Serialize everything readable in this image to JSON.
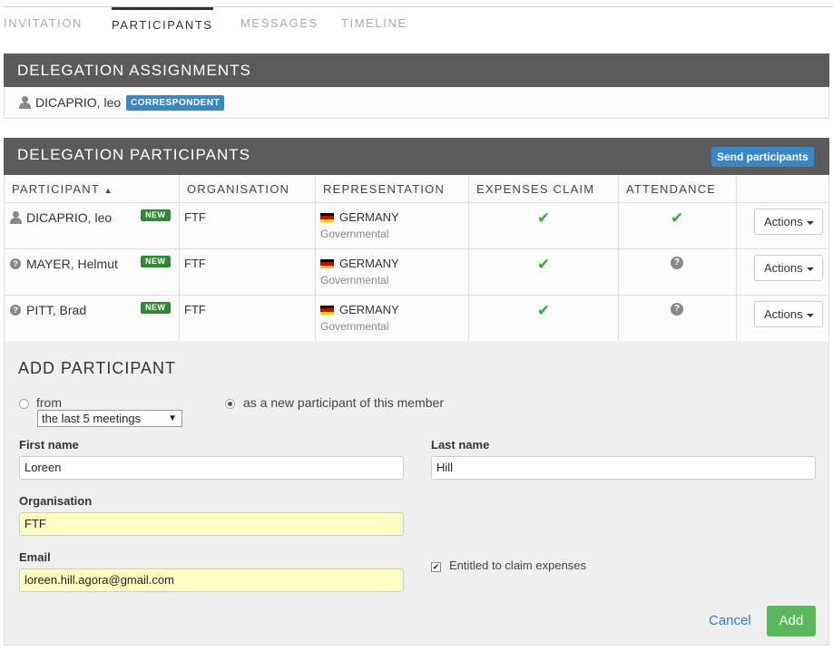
{
  "tabs": [
    {
      "label": "INVITATION",
      "active": false
    },
    {
      "label": "PARTICIPANTS",
      "active": true
    },
    {
      "label": "MESSAGES",
      "active": false
    },
    {
      "label": "TIMELINE",
      "active": false
    }
  ],
  "assignments": {
    "title": "DELEGATION ASSIGNMENTS",
    "person": "DICAPRIO, leo",
    "role_badge": "CORRESPONDENT"
  },
  "participants": {
    "title": "DELEGATION PARTICIPANTS",
    "send_button": "Send participants",
    "columns": {
      "participant": "PARTICIPANT",
      "organisation": "ORGANISATION",
      "representation": "REPRESENTATION",
      "expenses": "EXPENSES CLAIM",
      "attendance": "ATTENDANCE"
    },
    "sort_indicator": "▲",
    "rows": [
      {
        "name": "DICAPRIO, leo",
        "badge": "NEW",
        "org": "FTF",
        "country": "GERMANY",
        "rep_type": "Governmental",
        "expenses": "✔",
        "attendance": "✔",
        "actions": "Actions"
      },
      {
        "name": "MAYER, Helmut",
        "badge": "NEW",
        "org": "FTF",
        "country": "GERMANY",
        "rep_type": "Governmental",
        "expenses": "✔",
        "attendance": "?",
        "actions": "Actions"
      },
      {
        "name": "PITT, Brad",
        "badge": "NEW",
        "org": "FTF",
        "country": "GERMANY",
        "rep_type": "Governmental",
        "expenses": "✔",
        "attendance": "?",
        "actions": "Actions"
      }
    ]
  },
  "add": {
    "title": "ADD PARTICIPANT",
    "radio_from": "from",
    "from_select": "the last 5 meetings",
    "radio_new": "as a new participant of this member",
    "first_name_label": "First name",
    "first_name": "Loreen",
    "last_name_label": "Last name",
    "last_name": "Hill",
    "org_label": "Organisation",
    "org": "FTF",
    "email_label": "Email",
    "email": "loreen.hill.agora@gmail.com",
    "entitled_label": "Entitled to claim expenses",
    "entitled_checked": true,
    "cancel": "Cancel",
    "add_button": "Add"
  },
  "colors": {
    "header_bg": "#5a5a5a",
    "badge_blue": "#3a87c8",
    "badge_green": "#2f8a2f",
    "check_green": "#3aa83a",
    "add_green": "#5cb85c",
    "highlight_yellow": "#fbfec0"
  }
}
